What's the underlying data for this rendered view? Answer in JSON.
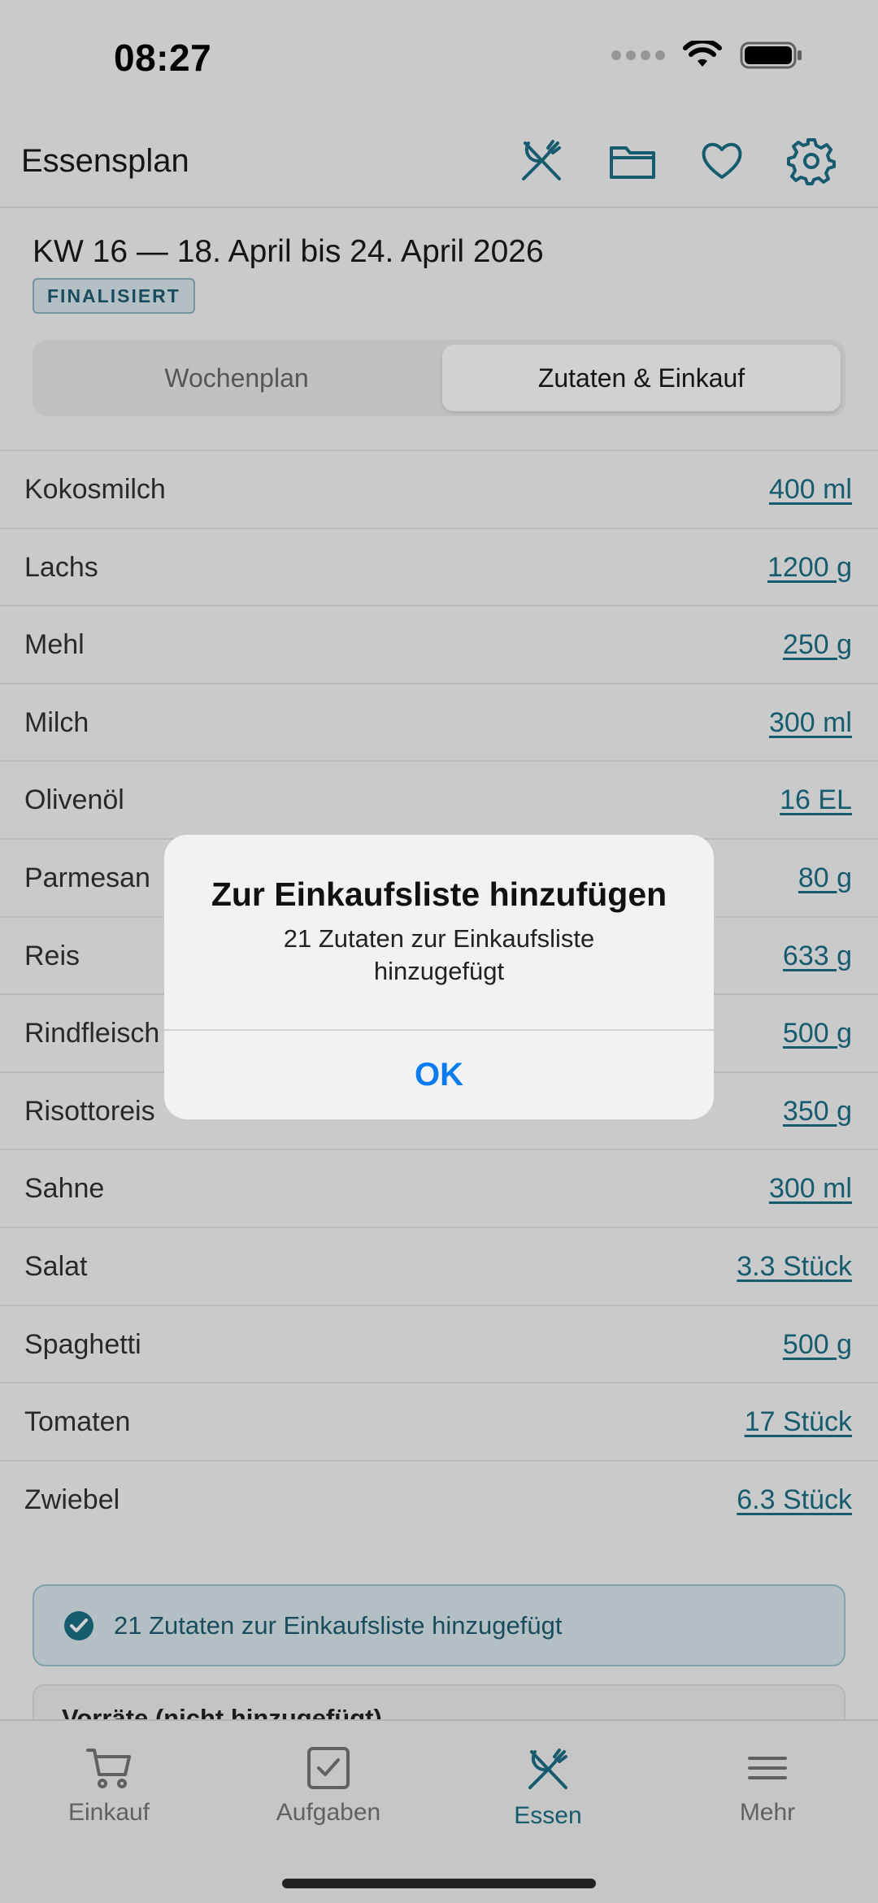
{
  "status_bar": {
    "time": "08:27"
  },
  "header": {
    "title": "Essensplan",
    "icons": [
      "utensils-icon",
      "folder-icon",
      "heart-icon",
      "gear-icon"
    ]
  },
  "week": {
    "title": "KW 16 — 18. April bis 24. April 2026",
    "badge": "FINALISIERT"
  },
  "segments": {
    "left": "Wochenplan",
    "right": "Zutaten & Einkauf",
    "selected": "Zutaten & Einkauf"
  },
  "ingredients": [
    {
      "name": "Kokosmilch",
      "qty": "400 ml"
    },
    {
      "name": "Lachs",
      "qty": "1200 g"
    },
    {
      "name": "Mehl",
      "qty": "250 g"
    },
    {
      "name": "Milch",
      "qty": "300 ml"
    },
    {
      "name": "Olivenöl",
      "qty": "16 EL"
    },
    {
      "name": "Parmesan",
      "qty": "80 g"
    },
    {
      "name": "Reis",
      "qty": "633 g"
    },
    {
      "name": "Rindfleisch",
      "qty": "500 g"
    },
    {
      "name": "Risottoreis",
      "qty": "350 g"
    },
    {
      "name": "Sahne",
      "qty": "300 ml"
    },
    {
      "name": "Salat",
      "qty": "3.3 Stück"
    },
    {
      "name": "Spaghetti",
      "qty": "500 g"
    },
    {
      "name": "Tomaten",
      "qty": "17 Stück"
    },
    {
      "name": "Zwiebel",
      "qty": "6.3 Stück"
    }
  ],
  "success_message": "21 Zutaten zur Einkaufsliste hinzugefügt",
  "stock_section": "Vorräte (nicht hinzugefügt)",
  "tabs": [
    {
      "label": "Einkauf",
      "icon": "cart-icon"
    },
    {
      "label": "Aufgaben",
      "icon": "checkbox-icon"
    },
    {
      "label": "Essen",
      "icon": "utensils-icon",
      "active": true
    },
    {
      "label": "Mehr",
      "icon": "menu-icon"
    }
  ],
  "alert": {
    "title": "Zur Einkaufsliste hinzufügen",
    "message": "21 Zutaten zur Einkaufsliste hinzugefügt",
    "ok_label": "OK"
  },
  "colors": {
    "accent": "#1d6f87",
    "ios_blue": "#0a7cf0"
  }
}
